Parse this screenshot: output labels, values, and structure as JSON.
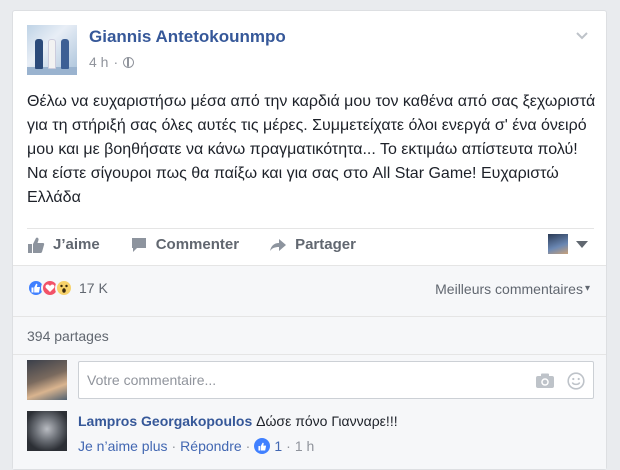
{
  "post": {
    "author": "Giannis Antetokounmpo",
    "time": "4 h",
    "separator": "·",
    "text": "Θέλω να ευχαριστήσω μέσα από την καρδιά μου τον καθένα από σας ξεχωριστά για τη στήριξή σας όλες αυτές τις μέρες. Συμμετείχατε όλοι ενεργά σ' ένα όνειρό μου και με βοηθήσατε να κάνω πραγματικότητα... Το εκτιμάω απίστευτα πολύ! Να είστε σίγουροι πως θα παίξω και για σας στο All Star Game! Ευχαριστώ Ελλάδα"
  },
  "actions": {
    "like": "J’aime",
    "comment": "Commenter",
    "share": "Partager"
  },
  "reactions": {
    "types": [
      "like",
      "love",
      "wow"
    ],
    "count": "17 K"
  },
  "sort": {
    "label": "Meilleurs commentaires"
  },
  "shares": "394 partages",
  "comment_input": {
    "placeholder": "Votre commentaire..."
  },
  "comments": [
    {
      "author": "Lampros Georgakopoulos",
      "text": "Δώσε πόνο Γιανναρε!!!",
      "unlike": "Je n’aime plus",
      "reply": "Répondre",
      "likes": "1",
      "time": "1 h",
      "separator": "·"
    }
  ],
  "colors": {
    "link": "#365899",
    "like_blue": "#4080ff",
    "love_red": "#f25268",
    "wow_yellow": "#f7d26b"
  }
}
